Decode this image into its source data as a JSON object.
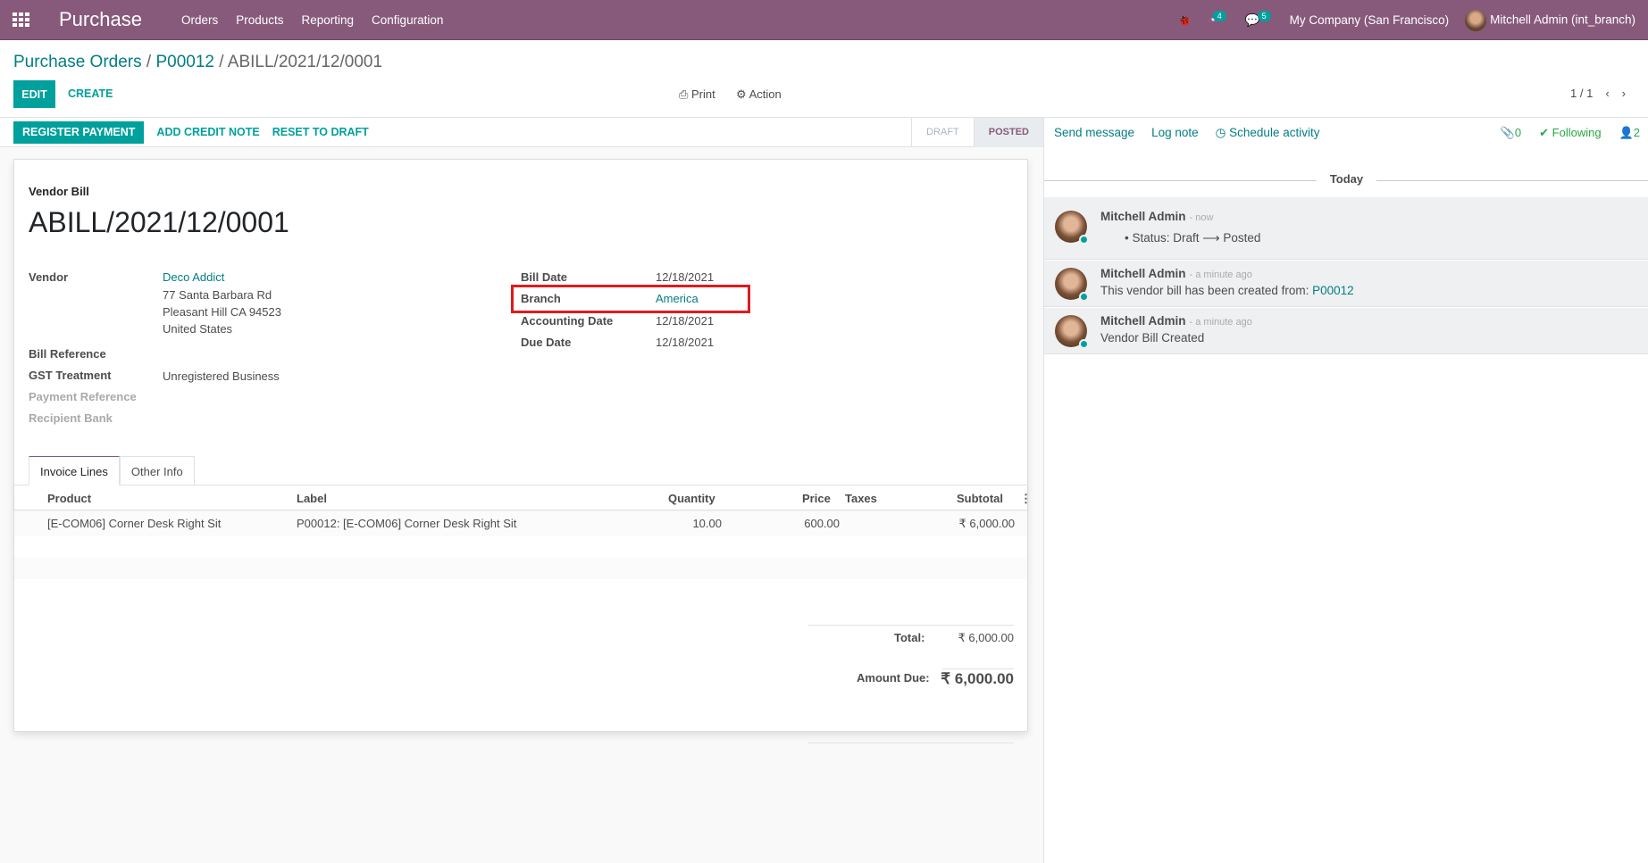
{
  "navbar": {
    "app_name": "Purchase",
    "menu": [
      "Orders",
      "Products",
      "Reporting",
      "Configuration"
    ],
    "activity_count": "4",
    "message_count": "5",
    "company": "My Company (San Francisco)",
    "user": "Mitchell Admin (int_branch)"
  },
  "breadcrumb": {
    "items": [
      "Purchase Orders",
      "P00012"
    ],
    "current": "ABILL/2021/12/0001",
    "sep": "/"
  },
  "toolbar": {
    "edit": "Edit",
    "create": "Create",
    "print": "Print",
    "action": "Action",
    "pager": "1 / 1"
  },
  "statusbar": {
    "buttons": [
      "Register Payment",
      "Add Credit Note",
      "Reset to Draft"
    ],
    "stages": [
      {
        "label": "Draft",
        "active": false
      },
      {
        "label": "Posted",
        "active": true
      }
    ]
  },
  "form": {
    "subtitle": "Vendor Bill",
    "title": "ABILL/2021/12/0001",
    "left_fields": {
      "vendor_label": "Vendor",
      "vendor_name": "Deco Addict",
      "vendor_address": [
        "77 Santa Barbara Rd",
        "Pleasant Hill CA 94523",
        "United States"
      ],
      "bill_reference_label": "Bill Reference",
      "gst_label": "GST Treatment",
      "gst_value": "Unregistered Business",
      "payment_reference_label": "Payment Reference",
      "recipient_bank_label": "Recipient Bank"
    },
    "right_fields": [
      {
        "label": "Bill Date",
        "value": "12/18/2021"
      },
      {
        "label": "Branch",
        "value": "America"
      },
      {
        "label": "Accounting Date",
        "value": "12/18/2021"
      },
      {
        "label": "Due Date",
        "value": "12/18/2021"
      }
    ],
    "tabs": [
      "Invoice Lines",
      "Other Info"
    ],
    "lines": {
      "columns": [
        "Product",
        "Label",
        "Quantity",
        "Price",
        "Taxes",
        "Subtotal"
      ],
      "rows": [
        {
          "product": "[E-COM06] Corner Desk Right Sit",
          "label": "P00012: [E-COM06] Corner Desk Right Sit",
          "quantity": "10.00",
          "price": "600.00",
          "taxes": "",
          "subtotal": "₹ 6,000.00"
        }
      ]
    },
    "totals": {
      "total_label": "Total:",
      "total": "₹ 6,000.00",
      "due_label": "Amount Due:",
      "due": "₹ 6,000.00"
    }
  },
  "chatter": {
    "send_message": "Send message",
    "log_note": "Log note",
    "schedule_activity": "Schedule activity",
    "attachments": "0",
    "following": "Following",
    "followers": "2",
    "date_separator": "Today",
    "messages": [
      {
        "author": "Mitchell Admin",
        "time": "- now",
        "body": "Status: Draft ⟶ Posted"
      },
      {
        "author": "Mitchell Admin",
        "time": "- a minute ago",
        "body": "This vendor bill has been created from: ",
        "link": "P00012"
      },
      {
        "author": "Mitchell Admin",
        "time": "- a minute ago",
        "body": "Vendor Bill Created"
      }
    ]
  },
  "colors": {
    "brand": "#875a7b",
    "accent": "#00a09d",
    "link": "#017e84",
    "highlight": "#e01b1b"
  }
}
